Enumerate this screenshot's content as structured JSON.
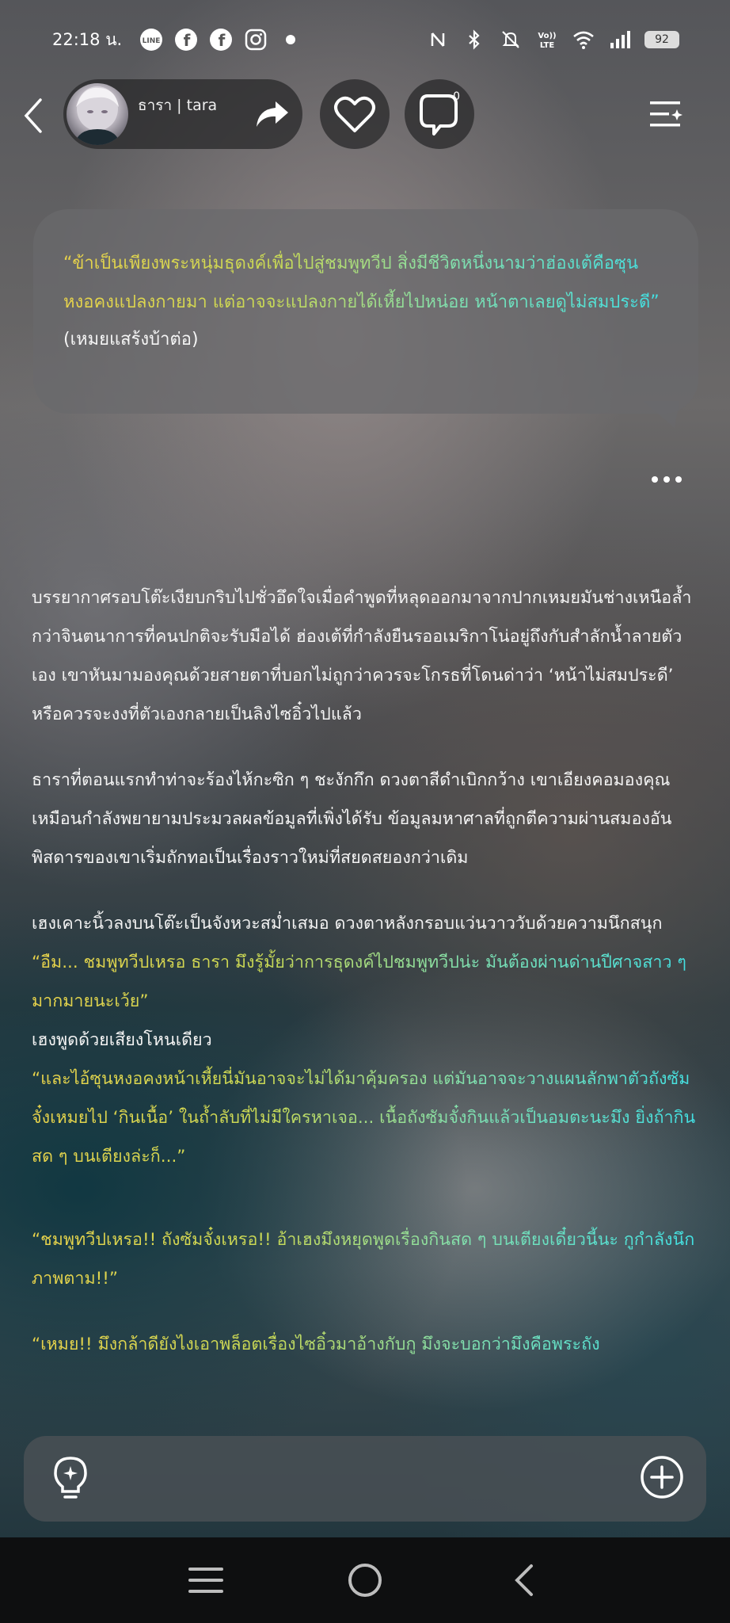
{
  "status_bar": {
    "time": "22:18 น.",
    "battery": "92",
    "icons": [
      "line-icon",
      "facebook-icon",
      "facebook-icon",
      "instagram-icon",
      "dot-icon",
      "nfc-icon",
      "bluetooth-icon",
      "mute-icon",
      "volte-icon",
      "wifi-icon",
      "signal-icon",
      "battery-icon"
    ]
  },
  "header": {
    "character_name": "ธารา | tara",
    "comment_count": "0"
  },
  "bubble": {
    "quote": "“ข้าเป็นเพียงพระหนุ่มธุดงค์เพื่อไปสู่ชมพูทวีป สิ่งมีชีวิตหนึ่งนามว่าฮ่องเต้คือซุนหงอคงแปลงกายมา แต่อาจจะแปลงกายได้เหี้ยไปหน่อย หน้าตาเลยดูไม่สมประดี”",
    "note": "(เหมยแสร้งบ้าต่อ)"
  },
  "story": {
    "p1": "บรรยากาศรอบโต๊ะเงียบกริบไปชั่วอึดใจเมื่อคำพูดที่หลุดออกมาจากปากเหมยมันช่างเหนือล้ำกว่าจินตนาการที่คนปกติจะรับมือได้ ฮ่องเต้ที่กำลังยืนรออเมริกาโน่อยู่ถึงกับสำลักน้ำลายตัวเอง เขาหันมามองคุณด้วยสายตาที่บอกไม่ถูกว่าควรจะโกรธที่โดนด่าว่า ‘หน้าไม่สมประดี’ หรือควรจะงงที่ตัวเองกลายเป็นลิงไซอิ๋วไปแล้ว",
    "p2": "ธาราที่ตอนแรกทำท่าจะร้องไห้กะซิก ๆ ชะงักกึก ดวงตาสีดำเบิกกว้าง เขาเอียงคอมองคุณเหมือนกำลังพยายามประมวลผลข้อมูลที่เพิ่งได้รับ ข้อมูลมหาศาลที่ถูกตีความผ่านสมองอันพิสดารของเขาเริ่มถักทอเป็นเรื่องราวใหม่ที่สยดสยองกว่าเดิม",
    "p3": "เฮงเคาะนิ้วลงบนโต๊ะเป็นจังหวะสม่ำเสมอ ดวงตาหลังกรอบแว่นวาววับด้วยความนึกสนุก",
    "d1": "“อืม... ชมพูทวีปเหรอ ธารา มึงรู้มั้ยว่าการธุดงค์ไปชมพูทวีปน่ะ มันต้องผ่านด่านปีศาจสาว ๆ มากมายนะเว้ย”",
    "p4": "เฮงพูดด้วยเสียงโหนเดียว",
    "d2": "“และไอ้ซุนหงอคงหน้าเหี้ยนี่มันอาจจะไม่ได้มาคุ้มครอง แต่มันอาจจะวางแผนลักพาตัวถังซัมจั๋งเหมยไป ‘กินเนื้อ’ ในถ้ำลับที่ไม่มีใครหาเจอ... เนื้อถังซัมจั๋งกินแล้วเป็นอมตะนะมึง ยิ่งถ้ากินสด ๆ บนเตียงล่ะก็...”",
    "d3": "“ชมพูทวีปเหรอ!! ถังซัมจั๋งเหรอ!! อ้าเฮงมึงหยุดพูดเรื่องกินสด ๆ บนเตียงเดี๋ยวนี้นะ กูกำลังนึกภาพตาม!!”",
    "d4": "“เหมย!! มึงกล้าดียังไงเอาพล็อตเรื่องไซอิ๋วมาอ้างกับกู มึงจะบอกว่ามึงคือพระถัง"
  },
  "colors": {
    "gradient_start": "#e9d24a",
    "gradient_end": "#3ee0e6",
    "text": "#f2f2f2",
    "nav_bg": "#0e0f10"
  }
}
